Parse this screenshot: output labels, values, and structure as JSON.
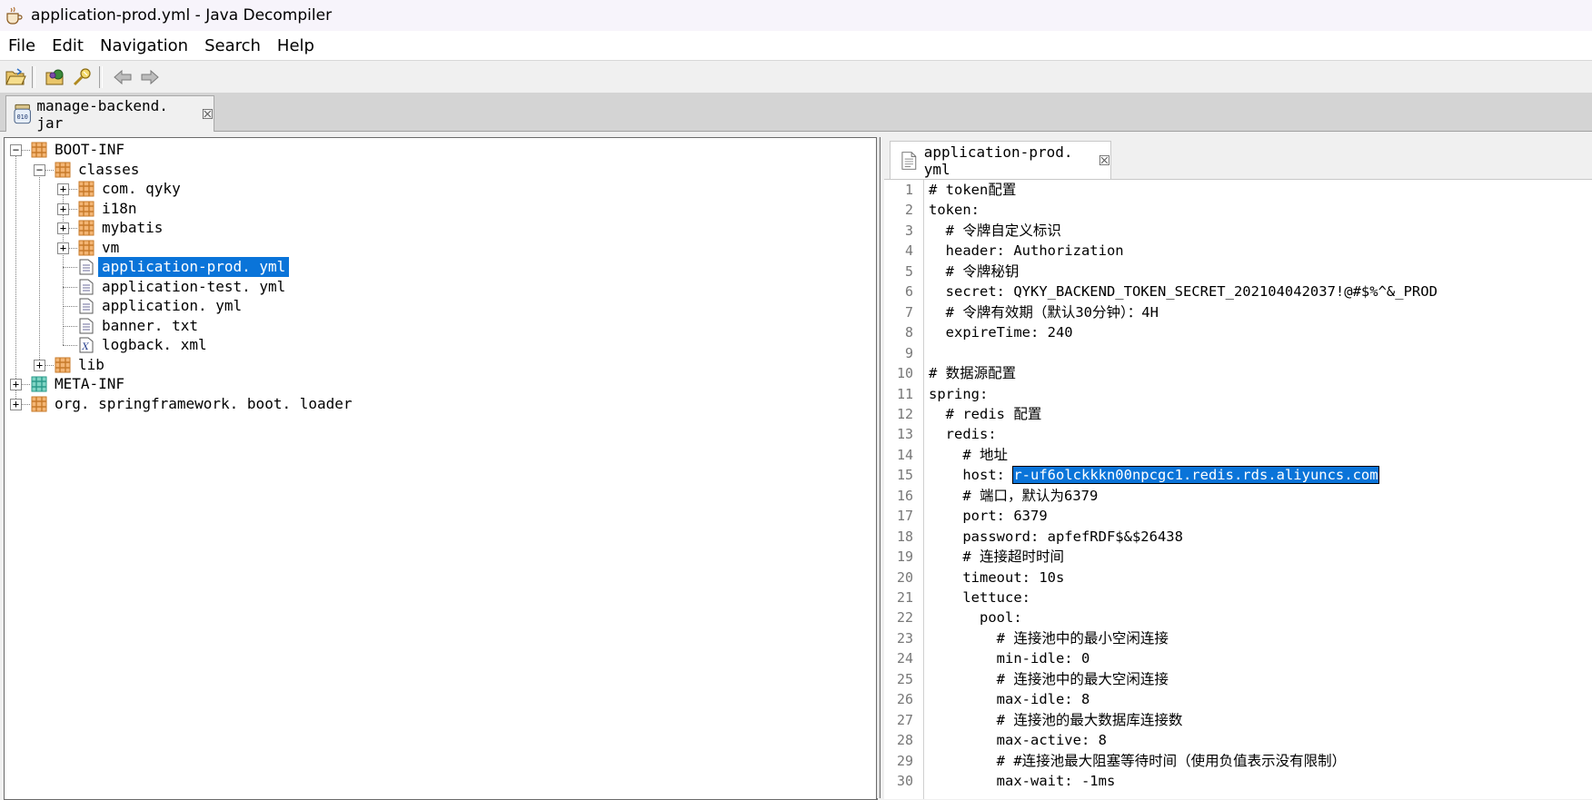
{
  "window": {
    "title": "application-prod.yml - Java Decompiler"
  },
  "menu": [
    "File",
    "Edit",
    "Navigation",
    "Search",
    "Help"
  ],
  "toolbar": {
    "buttons": [
      "open-file-icon",
      "open-type-icon",
      "search-icon",
      "back-icon",
      "forward-icon"
    ]
  },
  "file_tab": {
    "label": "manage-backend. jar"
  },
  "tree": [
    {
      "label": "BOOT-INF",
      "icon": "package-icon"
    },
    {
      "label": "classes",
      "icon": "package-icon"
    },
    {
      "label": "com. qyky",
      "icon": "package-icon"
    },
    {
      "label": "i18n",
      "icon": "package-icon"
    },
    {
      "label": "mybatis",
      "icon": "package-icon"
    },
    {
      "label": "vm",
      "icon": "package-icon"
    },
    {
      "label": "application-prod. yml",
      "icon": "file-icon",
      "selected": true
    },
    {
      "label": "application-test. yml",
      "icon": "file-icon"
    },
    {
      "label": "application. yml",
      "icon": "file-icon"
    },
    {
      "label": "banner. txt",
      "icon": "file-icon"
    },
    {
      "label": "logback. xml",
      "icon": "xml-file-icon"
    },
    {
      "label": "lib",
      "icon": "package-icon"
    },
    {
      "label": "META-INF",
      "icon": "meta-package-icon"
    },
    {
      "label": "org. springframework. boot. loader",
      "icon": "package-icon"
    }
  ],
  "code_tab": {
    "label": "application-prod. yml"
  },
  "code": {
    "line_numbers": [
      "1",
      "2",
      "3",
      "4",
      "5",
      "6",
      "7",
      "8",
      "9",
      "10",
      "11",
      "12",
      "13",
      "14",
      "15",
      "16",
      "17",
      "18",
      "19",
      "20",
      "21",
      "22",
      "23",
      "24",
      "25",
      "26",
      "27",
      "28",
      "29",
      "30"
    ],
    "lines": [
      "# token配置",
      "token:",
      "  # 令牌自定义标识",
      "  header: Authorization",
      "  # 令牌秘钥",
      "  secret: QYKY_BACKEND_TOKEN_SECRET_202104042037!@#$%^&_PROD",
      "  # 令牌有效期（默认30分钟）：4H",
      "  expireTime: 240",
      "",
      "# 数据源配置",
      "spring:",
      "  # redis 配置",
      "  redis:",
      "    # 地址",
      "    host: ",
      "    # 端口，默认为6379",
      "    port: 6379",
      "    password: apfefRDF$&$26438",
      "    # 连接超时时间",
      "    timeout: 10s",
      "    lettuce:",
      "      pool:",
      "        # 连接池中的最小空闲连接",
      "        min-idle: 0",
      "        # 连接池中的最大空闲连接",
      "        max-idle: 8",
      "        # 连接池的最大数据库连接数",
      "        max-active: 8",
      "        # #连接池最大阻塞等待时间（使用负值表示没有限制）",
      "        max-wait: -1ms"
    ],
    "selected_host": "r-uf6olckkkn00npcgc1.redis.rds.aliyuncs.com"
  }
}
